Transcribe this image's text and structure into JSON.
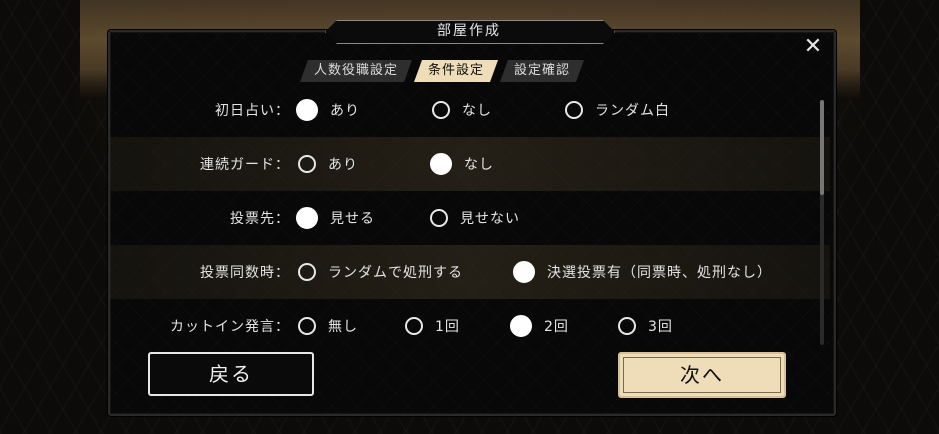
{
  "dialog": {
    "title": "部屋作成",
    "close_symbol": "✕"
  },
  "tabs": [
    {
      "label": "人数役職設定",
      "active": false
    },
    {
      "label": "条件設定",
      "active": true
    },
    {
      "label": "設定確認",
      "active": false
    }
  ],
  "rows": [
    {
      "label": "初日占い：",
      "options": [
        {
          "label": "あり",
          "selected": true
        },
        {
          "label": "なし",
          "selected": false
        },
        {
          "label": "ランダム白",
          "selected": false
        }
      ]
    },
    {
      "label": "連続ガード：",
      "options": [
        {
          "label": "あり",
          "selected": false
        },
        {
          "label": "なし",
          "selected": true
        }
      ]
    },
    {
      "label": "投票先：",
      "options": [
        {
          "label": "見せる",
          "selected": true
        },
        {
          "label": "見せない",
          "selected": false
        }
      ]
    },
    {
      "label": "投票同数時：",
      "options": [
        {
          "label": "ランダムで処刑する",
          "selected": false
        },
        {
          "label": "決選投票有（同票時、処刑なし）",
          "selected": true
        }
      ]
    },
    {
      "label": "カットイン発言：",
      "options": [
        {
          "label": "無し",
          "selected": false
        },
        {
          "label": "1回",
          "selected": false
        },
        {
          "label": "2回",
          "selected": true
        },
        {
          "label": "3回",
          "selected": false
        }
      ]
    }
  ],
  "buttons": {
    "back_label": "戻る",
    "next_label": "次へ"
  },
  "colors": {
    "accent": "#efdcb8",
    "background": "#080808",
    "text": "#e4e4e4"
  }
}
